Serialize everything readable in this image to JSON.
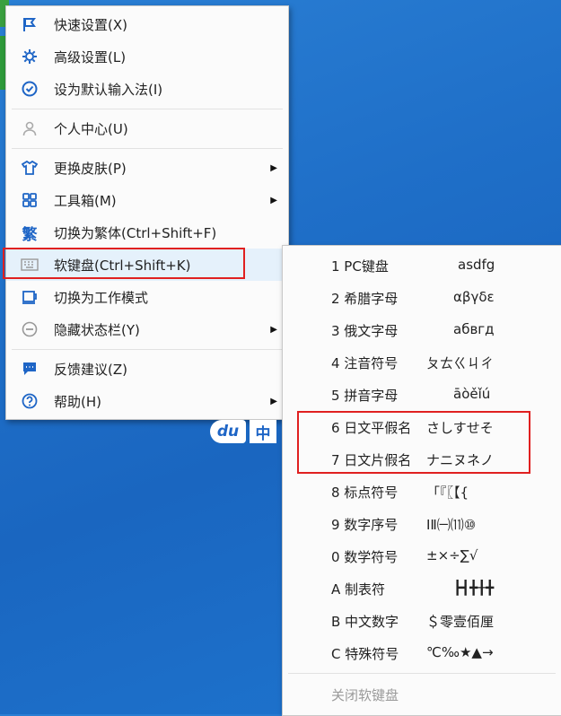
{
  "main_menu": {
    "items": [
      {
        "label": "快速设置(X)",
        "icon": "flag-icon",
        "has_submenu": false
      },
      {
        "label": "高级设置(L)",
        "icon": "gear-icon",
        "has_submenu": false
      },
      {
        "label": "设为默认输入法(I)",
        "icon": "check-circle-icon",
        "has_submenu": false
      },
      {
        "label": "个人中心(U)",
        "icon": "person-icon",
        "has_submenu": false
      },
      {
        "label": "更换皮肤(P)",
        "icon": "shirt-icon",
        "has_submenu": true
      },
      {
        "label": "工具箱(M)",
        "icon": "grid-icon",
        "has_submenu": true
      },
      {
        "label": "切换为繁体(Ctrl+Shift+F)",
        "icon": "traditional-char-icon",
        "has_submenu": false
      },
      {
        "label": "软键盘(Ctrl+Shift+K)",
        "icon": "keyboard-icon",
        "has_submenu": true
      },
      {
        "label": "切换为工作模式",
        "icon": "work-mode-icon",
        "has_submenu": false
      },
      {
        "label": "隐藏状态栏(Y)",
        "icon": "minus-circle-icon",
        "has_submenu": true
      },
      {
        "label": "反馈建议(Z)",
        "icon": "feedback-icon",
        "has_submenu": false
      },
      {
        "label": "帮助(H)",
        "icon": "help-icon",
        "has_submenu": true
      }
    ]
  },
  "soft_keyboard_menu": {
    "items": [
      {
        "label": "1 PC键盘",
        "preview": "asdfg"
      },
      {
        "label": "2 希腊字母",
        "preview": "αβγδε"
      },
      {
        "label": "3 俄文字母",
        "preview": "абвгд"
      },
      {
        "label": "4 注音符号",
        "preview": "ㄆㄊㄍㄐㄔ"
      },
      {
        "label": "5 拼音字母",
        "preview": "āòěǐú"
      },
      {
        "label": "6 日文平假名",
        "preview": "さしすせそ"
      },
      {
        "label": "7 日文片假名",
        "preview": "ナニヌネノ"
      },
      {
        "label": "8 标点符号",
        "preview": "「『〖【{"
      },
      {
        "label": "9 数字序号",
        "preview": "ⅠⅡ㈠⑾⑩"
      },
      {
        "label": "0 数学符号",
        "preview": "±×÷∑√"
      },
      {
        "label": "A 制表符",
        "preview": "┣┫╋╂╋"
      },
      {
        "label": "B 中文数字",
        "preview": "＄零壹佰厘"
      },
      {
        "label": "C 特殊符号",
        "preview": "℃‰★▲→"
      },
      {
        "label": "关闭软键盘",
        "preview": "",
        "disabled": true
      }
    ]
  },
  "ime_status": {
    "logo": "du",
    "mode": "中"
  },
  "colors": {
    "accent": "#1e65c6",
    "highlight_box": "#e02020"
  }
}
